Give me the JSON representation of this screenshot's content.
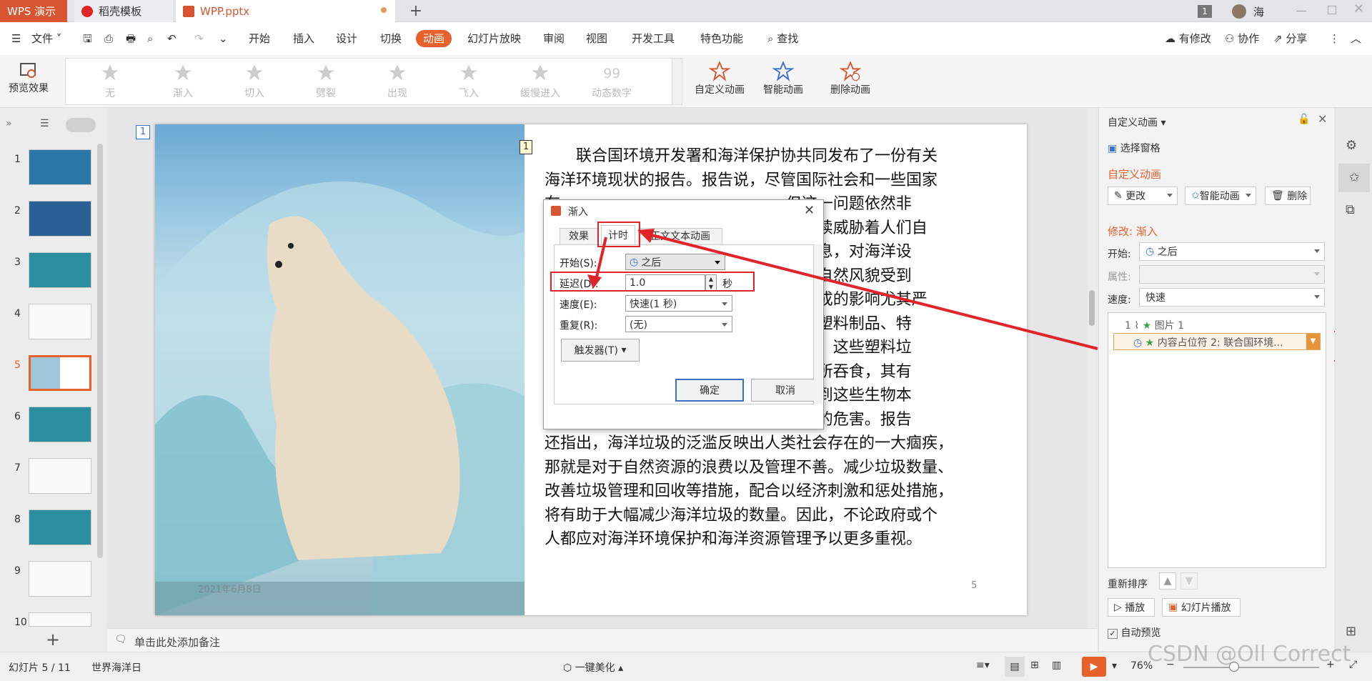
{
  "tabs": {
    "wps": "WPS 演示",
    "template": "稻壳模板",
    "file": "WPP.pptx"
  },
  "user": {
    "badge": "1",
    "name": "海"
  },
  "menu": {
    "file": "文件",
    "items": [
      "开始",
      "插入",
      "设计",
      "切换",
      "动画",
      "幻灯片放映",
      "审阅",
      "视图",
      "开发工具",
      "特色功能"
    ],
    "active": "动画",
    "search": "查找",
    "modified": "有修改",
    "collab": "协作",
    "share": "分享"
  },
  "ribbon": {
    "preview": "预览效果",
    "gallery": [
      "无",
      "渐入",
      "切入",
      "劈裂",
      "出现",
      "飞入",
      "缓慢进入",
      "动态数字"
    ],
    "custom": "自定义动画",
    "smart": "智能动画",
    "delete": "删除动画"
  },
  "slides": {
    "count": [
      "1",
      "2",
      "3",
      "4",
      "5",
      "6",
      "7",
      "8",
      "9",
      "10"
    ],
    "active": "5"
  },
  "slide": {
    "marker_top": "1",
    "marker_text": "1",
    "number": "5",
    "footer_date": "2021年6月8日",
    "text_lines": [
      {
        "t": "　　联合国环境开发署和海洋保护协共同发布了一份有关",
        "b": false
      },
      {
        "t": "海洋环境现状的报告。报告说，尽管国际社会和一些国家",
        "b": false
      },
      {
        "t": "在                                          ，但这一问题依然非",
        "b": false
      },
      {
        "t": "常                                          正在继续威胁着人们自",
        "b": false
      },
      {
        "t": "身                                          繁衍生息，对海洋设",
        "b": false
      },
      {
        "t": "施                                          海地区自然风貌受到",
        "b": false
      },
      {
        "t": "了                                          料袋造成的影响尤其严",
        "b": false
      },
      {
        "t": "重                                          淘汰。塑料制品、特",
        "b": false
      },
      {
        "t": "别                                          洋垃圾，这些塑料垃",
        "b": false
      },
      {
        "t": "圾                                          洋生物所吞食，其有",
        "b": false
      },
      {
        "t": "毒                                          仅威胁到这些生物本",
        "b": false
      },
      {
        "t": "身                                          更广泛的危害。报告",
        "b": false
      },
      {
        "t": "还指出，海洋垃圾的泛滥反映出人类社会存在的一大痼疾，",
        "b": false
      },
      {
        "t": "那就是对于自然资源的浪费以及管理不善。减少垃圾数量、",
        "b": false
      },
      {
        "t": "改善垃圾管理和回收等措施，配合以经济刺激和惩处措施，",
        "b": false
      },
      {
        "t": "将有助于大幅减少海洋垃圾的数量。因此，不论政府或个",
        "b": false
      },
      {
        "t": "人都应对海洋环境保护和海洋资源管理予以更多重视。",
        "b": false
      }
    ]
  },
  "dialog": {
    "title": "渐入",
    "tabs": [
      "效果",
      "计时",
      "正文文本动画"
    ],
    "start_label": "开始(S):",
    "start_value": "之后",
    "delay_label": "延迟(D):",
    "delay_value": "1.0",
    "delay_unit": "秒",
    "speed_label": "速度(E):",
    "speed_value": "快速(1 秒)",
    "repeat_label": "重复(R):",
    "repeat_value": "(无)",
    "trigger": "触发器(T)",
    "ok": "确定",
    "cancel": "取消"
  },
  "panel": {
    "title": "自定义动画",
    "select_pane": "选择窗格",
    "section": "自定义动画",
    "change": "更改",
    "smart": "智能动画",
    "delete": "删除",
    "modify": "修改: 渐入",
    "start_label": "开始:",
    "start_value": "之后",
    "prop_label": "属性:",
    "speed_label": "速度:",
    "speed_value": "快速",
    "list": [
      {
        "num": "1",
        "text": "图片 1"
      },
      {
        "num": "",
        "text": "内容占位符 2: 联合国环境..."
      }
    ],
    "reorder": "重新排序",
    "play": "播放",
    "slideshow": "幻灯片播放",
    "auto_preview": "自动预览"
  },
  "notes": {
    "placeholder": "单击此处添加备注"
  },
  "status": {
    "slide": "幻灯片 5 / 11",
    "theme": "世界海洋日",
    "beautify": "一键美化",
    "zoom": "76%"
  },
  "watermark": "CSDN @Oll Correct",
  "colors": {
    "accent": "#e8602c",
    "annotation": "#e0242a"
  }
}
